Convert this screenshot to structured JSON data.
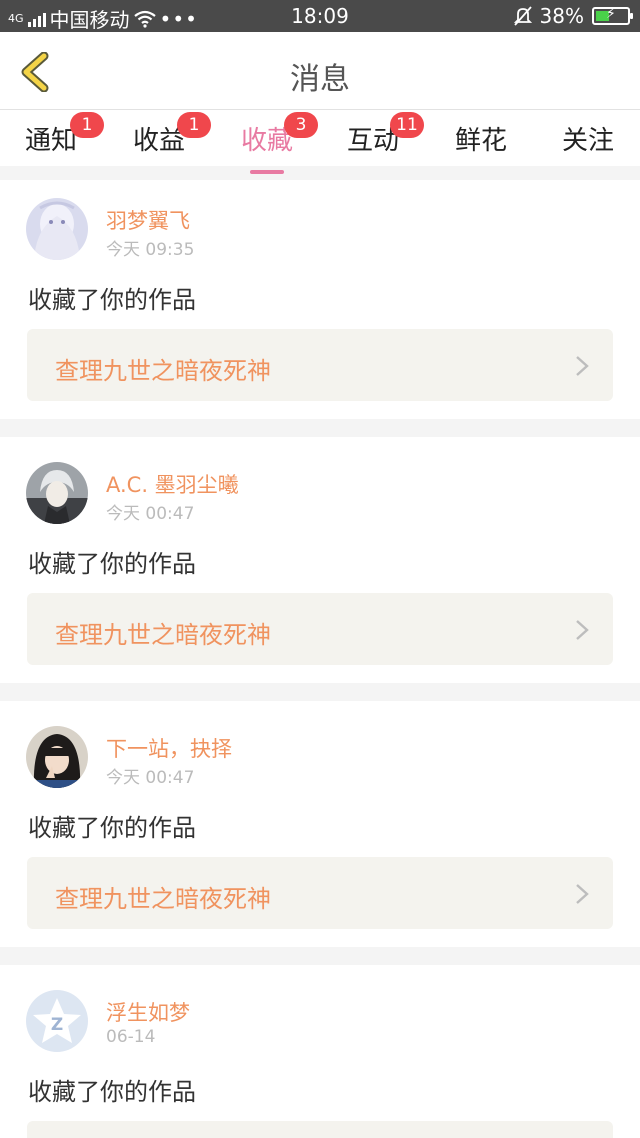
{
  "status": {
    "network": "4G",
    "carrier": "中国移动",
    "time": "18:09",
    "battery": "38%"
  },
  "header": {
    "title": "消息"
  },
  "tabs": [
    {
      "label": "通知",
      "badge": "1"
    },
    {
      "label": "收益",
      "badge": "1"
    },
    {
      "label": "收藏",
      "badge": "3",
      "active": true
    },
    {
      "label": "互动",
      "badge": "11"
    },
    {
      "label": "鲜花",
      "badge": ""
    },
    {
      "label": "关注",
      "badge": ""
    }
  ],
  "items": [
    {
      "name": "羽梦翼飞",
      "time": "今天 09:35",
      "action": "收藏了你的作品",
      "work": "查理九世之暗夜死神"
    },
    {
      "name": "A.C. 墨羽尘曦",
      "time": "今天 00:47",
      "action": "收藏了你的作品",
      "work": "查理九世之暗夜死神"
    },
    {
      "name": "下一站，抉择",
      "time": "今天 00:47",
      "action": "收藏了你的作品",
      "work": "查理九世之暗夜死神"
    },
    {
      "name": "浮生如梦",
      "time": "06-14",
      "action": "收藏了你的作品",
      "work": ""
    }
  ],
  "colors": {
    "accent_pink": "#e87aa2",
    "name_orange": "#f0935f",
    "badge_red": "#f0474c",
    "back_arrow": "#f4d447"
  }
}
